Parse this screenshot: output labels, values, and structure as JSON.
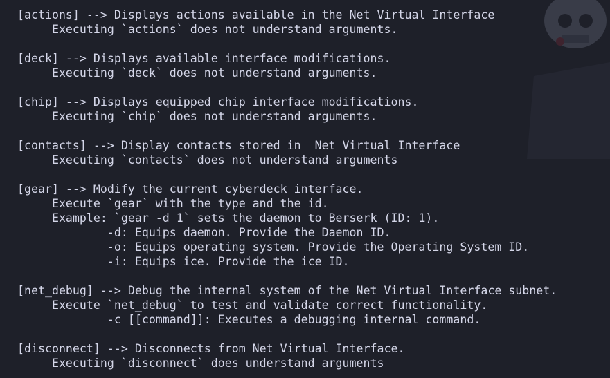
{
  "background": {
    "art_icon": "skull-pirate-art-icon",
    "color": "#1e2029"
  },
  "lines": [
    "[actions] --> Displays actions available in the Net Virtual Interface",
    "     Executing `actions` does not understand arguments.",
    "",
    "[deck] --> Displays available interface modifications.",
    "     Executing `deck` does not understand arguments.",
    "",
    "[chip] --> Displays equipped chip interface modifications.",
    "     Executing `chip` does not understand arguments.",
    "",
    "[contacts] --> Display contacts stored in  Net Virtual Interface",
    "     Executing `contacts` does not understand arguments",
    "",
    "[gear] --> Modify the current cyberdeck interface.",
    "     Execute `gear` with the type and the id.",
    "     Example: `gear -d 1` sets the daemon to Berserk (ID: 1).",
    "             -d: Equips daemon. Provide the Daemon ID.",
    "             -o: Equips operating system. Provide the Operating System ID.",
    "             -i: Equips ice. Provide the ice ID.",
    "",
    "[net_debug] --> Debug the internal system of the Net Virtual Interface subnet.",
    "     Execute `net_debug` to test and validate correct functionality.",
    "             -c [[command]]: Executes a debugging internal command.",
    "",
    "[disconnect] --> Disconnects from Net Virtual Interface.",
    "     Executing `disconnect` does understand arguments"
  ]
}
